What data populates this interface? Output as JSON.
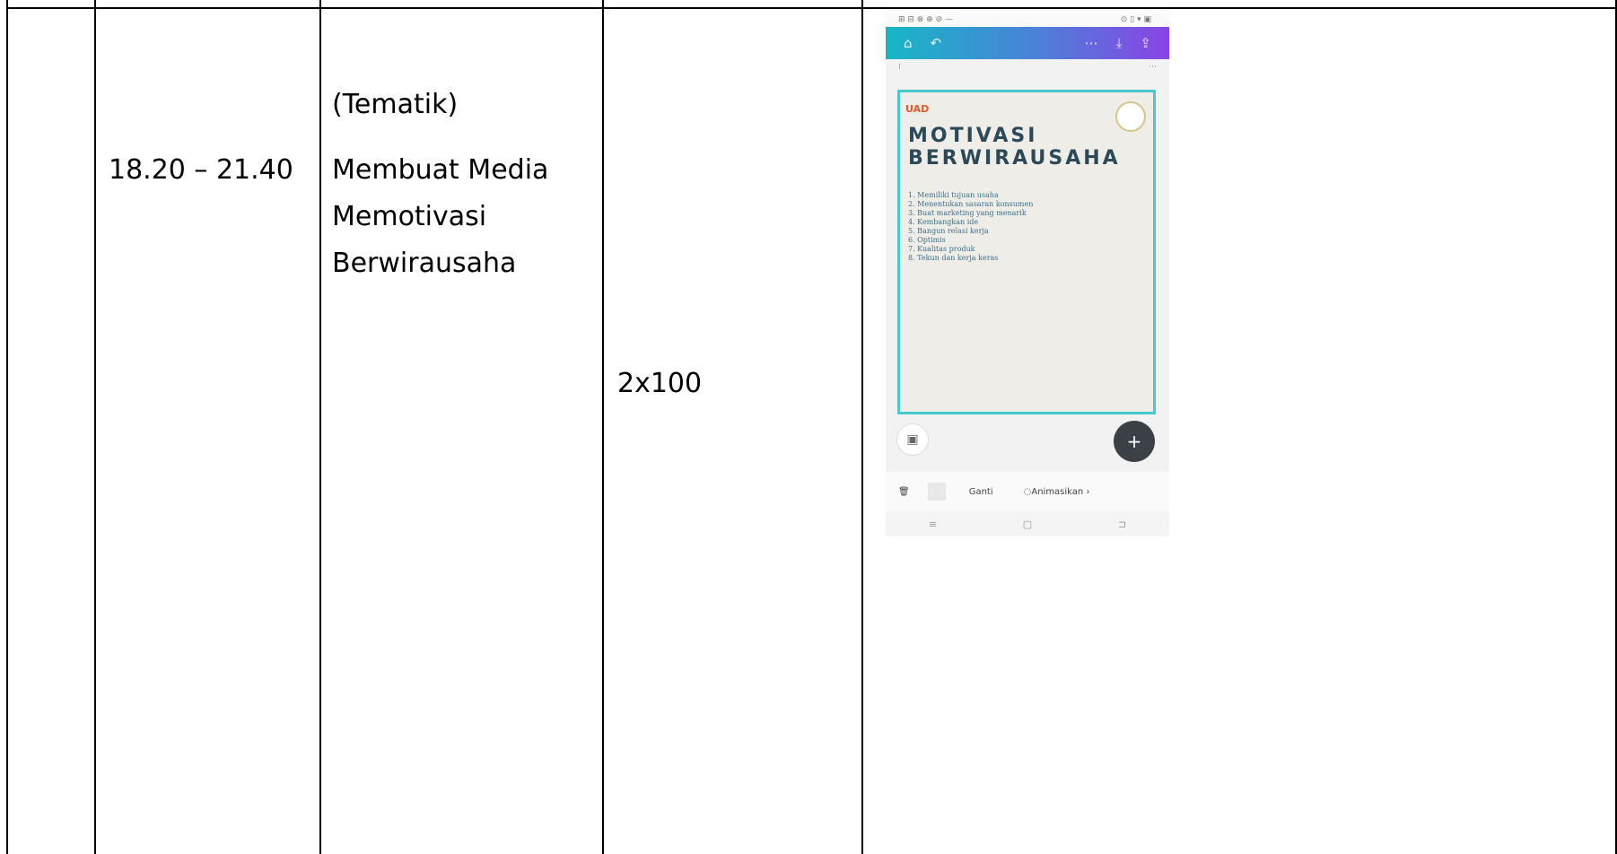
{
  "table": {
    "time": "18.20 – 21.40",
    "activity": {
      "category": "(Tematik)",
      "line1": "Membuat Media",
      "line2": "Memotivasi",
      "line3": "Berwirausaha"
    },
    "volume": "2x100"
  },
  "phone": {
    "status_left": "⊞ ⊟ ⊗ ⊕ ⊘ —",
    "status_right": "⊙ ▯ ▾ ▣",
    "card": {
      "logo": "UAD",
      "title_line1": "MOTIVASI",
      "title_line2": "BERWIRAUSAHA",
      "list": [
        "1. Memiliki tujuan usaha",
        "2. Menentukan sasaran konsumen",
        "3. Buat marketing yang menarik",
        "4. Kembangkan ide",
        "5. Bangun relasi kerja",
        "6. Optimis",
        "7. Kualitas produk",
        "8. Tekun dan kerja keras"
      ]
    },
    "bottom": {
      "ganti": "Ganti",
      "animasikan": "Animasikan"
    }
  }
}
